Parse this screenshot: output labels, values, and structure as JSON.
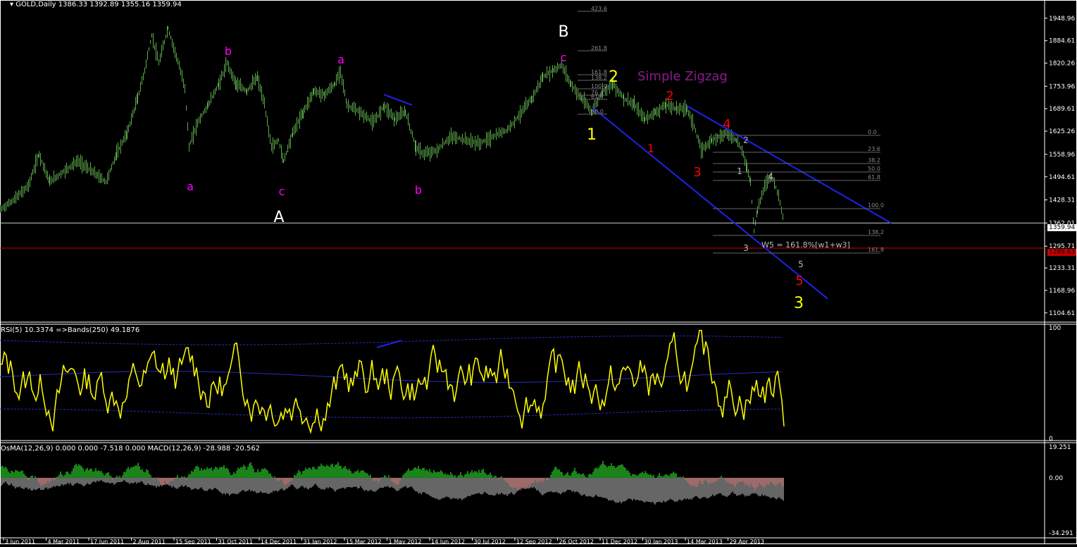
{
  "header": {
    "symbol": "GOLD,Daily",
    "ohlc": "1386.33 1392.89 1355.16 1359.94"
  },
  "chart_data": [
    {
      "type": "line",
      "title": "GOLD,Daily",
      "yaxis_ticks": [
        "1948.96",
        "1884.61",
        "1820.26",
        "1753.96",
        "1689.61",
        "1625.26",
        "1558.96",
        "1494.61",
        "1428.31",
        "1362.01",
        "1295.71",
        "1233.31",
        "1168.96",
        "1104.61"
      ],
      "ylim": [
        1080,
        1985
      ],
      "current_price": "1359.94",
      "target_level": "1289.63",
      "price_path": [
        [
          0,
          1400
        ],
        [
          20,
          1430
        ],
        [
          40,
          1470
        ],
        [
          55,
          1560
        ],
        [
          70,
          1480
        ],
        [
          90,
          1510
        ],
        [
          110,
          1540
        ],
        [
          130,
          1510
        ],
        [
          150,
          1480
        ],
        [
          165,
          1560
        ],
        [
          180,
          1620
        ],
        [
          195,
          1720
        ],
        [
          205,
          1800
        ],
        [
          215,
          1900
        ],
        [
          225,
          1820
        ],
        [
          238,
          1920
        ],
        [
          250,
          1840
        ],
        [
          262,
          1750
        ],
        [
          268,
          1580
        ],
        [
          280,
          1650
        ],
        [
          295,
          1700
        ],
        [
          310,
          1760
        ],
        [
          322,
          1820
        ],
        [
          335,
          1760
        ],
        [
          350,
          1740
        ],
        [
          365,
          1780
        ],
        [
          375,
          1700
        ],
        [
          385,
          1580
        ],
        [
          395,
          1600
        ],
        [
          402,
          1540
        ],
        [
          415,
          1620
        ],
        [
          430,
          1680
        ],
        [
          445,
          1740
        ],
        [
          460,
          1730
        ],
        [
          475,
          1760
        ],
        [
          483,
          1800
        ],
        [
          492,
          1700
        ],
        [
          510,
          1680
        ],
        [
          530,
          1650
        ],
        [
          545,
          1700
        ],
        [
          560,
          1660
        ],
        [
          575,
          1680
        ],
        [
          590,
          1580
        ],
        [
          600,
          1560
        ],
        [
          620,
          1570
        ],
        [
          640,
          1610
        ],
        [
          660,
          1600
        ],
        [
          680,
          1590
        ],
        [
          700,
          1610
        ],
        [
          720,
          1630
        ],
        [
          740,
          1680
        ],
        [
          755,
          1720
        ],
        [
          770,
          1780
        ],
        [
          785,
          1800
        ],
        [
          797,
          1815
        ],
        [
          810,
          1760
        ],
        [
          825,
          1720
        ],
        [
          840,
          1680
        ],
        [
          855,
          1740
        ],
        [
          870,
          1760
        ],
        [
          885,
          1720
        ],
        [
          900,
          1700
        ],
        [
          915,
          1660
        ],
        [
          930,
          1680
        ],
        [
          945,
          1700
        ],
        [
          960,
          1690
        ],
        [
          975,
          1690
        ],
        [
          985,
          1640
        ],
        [
          995,
          1570
        ],
        [
          1010,
          1600
        ],
        [
          1030,
          1620
        ],
        [
          1045,
          1600
        ],
        [
          1055,
          1560
        ],
        [
          1060,
          1520
        ],
        [
          1065,
          1480
        ],
        [
          1070,
          1340
        ],
        [
          1075,
          1400
        ],
        [
          1085,
          1470
        ],
        [
          1095,
          1500
        ],
        [
          1105,
          1440
        ],
        [
          1113,
          1360
        ]
      ],
      "fib_grid_1": [
        "423.6",
        "261.8",
        "161.8",
        "138.2",
        "100.0",
        "76.4",
        "61.8",
        "50.0"
      ],
      "fib_grid_2": [
        "0.0",
        "23.6",
        "38.2",
        "50.0",
        "61.8",
        "100.0",
        "138.2",
        "161.8"
      ],
      "wave_labels": {
        "A": "A",
        "B": "B",
        "a1": "a",
        "b1": "b",
        "c1": "c",
        "a2": "a",
        "b2": "b",
        "c2": "c",
        "c3": "c",
        "y1": "1",
        "y2": "2",
        "y3": "3",
        "r1": "1",
        "r2": "2",
        "r3": "3",
        "r4": "4",
        "r5": "5",
        "w1": "1",
        "w2": "2",
        "w3": "3",
        "w4": "4",
        "w5": "5"
      },
      "annotations": {
        "simple_zigzag": "Simple Zigzag",
        "w5_formula": "W5 = 161.8%[w1+w3]"
      }
    },
    {
      "type": "line",
      "title": "RSI(5) 10.3374 =>Bands(250) 49.1876",
      "yaxis_ticks": [
        "100",
        "0"
      ],
      "ylim": [
        0,
        100
      ],
      "rsi_last": 10.3374,
      "bands_mid": 49.1876
    },
    {
      "type": "bar",
      "title": "OsMA(12,26,9) 0.000 0.000 -7.518 0.000  MACD(12,26,9) -28.988 -20.562",
      "yaxis_ticks": [
        "19.251",
        "0.00",
        "-34.291"
      ],
      "ylim": [
        -34.291,
        19.251
      ]
    }
  ],
  "x_axis": {
    "labels": [
      "3 Jun 2011",
      "4 Mar 2011",
      "17 Jun 2011",
      "2 Aug 2011",
      "15 Sep 2011",
      "31 Oct 2011",
      "14 Dec 2011",
      "31 Jan 2012",
      "15 Mar 2012",
      "1 May 2012",
      "14 Jun 2012",
      "30 Jul 2012",
      "12 Sep 2012",
      "26 Oct 2012",
      "11 Dec 2012",
      "30 Jan 2013",
      "14 Mar 2013",
      "29 Apr 2013"
    ]
  },
  "colors": {
    "background": "#000000",
    "candles": "#5daa4a",
    "channel": "#1e22e8",
    "rsi": "#ffff00",
    "bands": "#2a2ac8",
    "osma_pos": "#22b022",
    "osma_neg": "#e01010",
    "macd": "#cccccc",
    "current_line": "#c8c8c8",
    "target_line": "#cc0000"
  }
}
